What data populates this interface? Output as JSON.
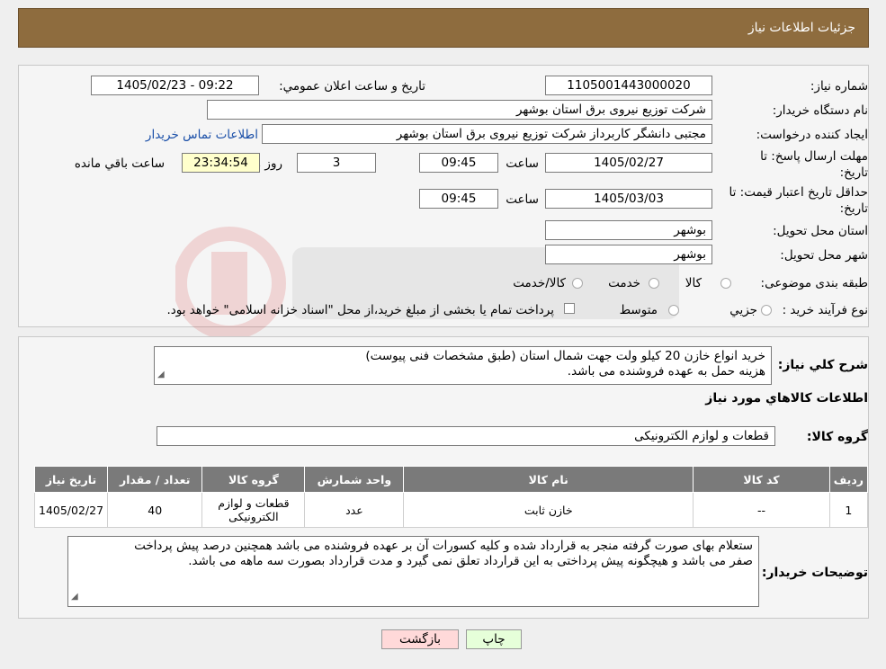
{
  "header": {
    "title": "جزئیات اطلاعات نیاز"
  },
  "form": {
    "need_number_label": "شماره نیاز:",
    "need_number": "1105001443000020",
    "announce_label": "تاریخ و ساعت اعلان عمومي:",
    "announce_value": "1405/02/23 - 09:22",
    "buyer_label": "نام دستگاه خريدار:",
    "buyer_value": "شرکت توزیع نیروی برق استان بوشهر",
    "creator_label": "ايجاد کننده درخواست:",
    "creator_value": "مجتبی دانشگر کاربرداز شرکت توزیع نیروی برق استان بوشهر",
    "contact_link": "اطلاعات تماس خريدار",
    "deadline_label_1": "مهلت ارسال پاسخ: تا",
    "deadline_label_2": "تاريخ:",
    "deadline_date": "1405/02/27",
    "time_label": "ساعت",
    "deadline_time": "09:45",
    "days_value": "3",
    "days_label": "روز و",
    "remaining_time": "23:34:54",
    "remaining_label": "ساعت باقي مانده",
    "validity_label_1": "حداقل تاريخ اعتبار قيمت: تا",
    "validity_label_2": "تاريخ:",
    "validity_date": "1405/03/03",
    "validity_time": "09:45",
    "province_label": "استان محل تحويل:",
    "province_value": "بوشهر",
    "city_label": "شهر محل تحويل:",
    "city_value": "بوشهر",
    "category_label": "طبقه بندی موضوعی:",
    "category_options": [
      "کالا",
      "خدمت",
      "کالا/خدمت"
    ],
    "process_label": "نوع فرآيند خريد :",
    "process_options": [
      "جزيي",
      "متوسط"
    ],
    "payment_note": "پرداخت تمام یا بخشی از مبلغ خرید،از محل \"اسناد خزانه اسلامی\" خواهد بود."
  },
  "details": {
    "summary_label": "شرح کلي نياز:",
    "summary_line1": "خرید انواع خازن 20 کیلو ولت جهت شمال استان (طبق مشخصات فنی پیوست)",
    "summary_line2": "هزینه حمل به عهده فروشنده می باشد.",
    "goods_info_title": "اطلاعات کالاهاي مورد نياز",
    "goods_group_label": "گروه کالا:",
    "goods_group_value": "قطعات و لوازم الکترونیکی"
  },
  "table": {
    "headers": [
      "رديف",
      "کد کالا",
      "نام کالا",
      "واحد شمارش",
      "گروه کالا",
      "تعداد / مقدار",
      "تاريخ نياز"
    ],
    "rows": [
      [
        "1",
        "--",
        "خازن ثابت",
        "عدد",
        "قطعات و لوازم الکترونیکی",
        "40",
        "1405/02/27"
      ]
    ]
  },
  "buyer_notes": {
    "label": "توضيحات خريدار:",
    "line1": "ستعلام بهای صورت گرفته منجر به قرارداد شده و کلیه کسورات آن بر عهده فروشنده می باشد همچنین درصد پیش پرداخت",
    "line2": "صفر می باشد و هیچگونه پیش پرداختی به این قرارداد تعلق نمی گیرد و مدت قرارداد بصورت سه ماهه می باشد."
  },
  "buttons": {
    "print": "چاپ",
    "back": "بازگشت"
  },
  "colors": {
    "header": "#8e6c3e",
    "back_button": "#ffd9d9",
    "print_button": "#e6ffd9",
    "link": "#1a4fa8"
  }
}
